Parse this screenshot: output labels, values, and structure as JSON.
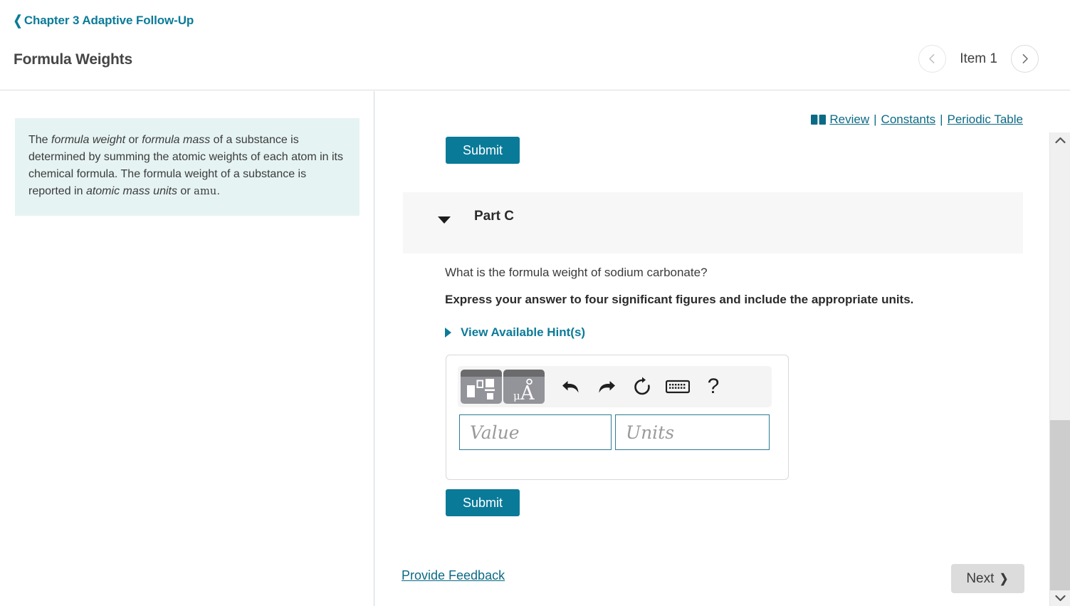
{
  "header": {
    "breadcrumb": "Chapter 3 Adaptive Follow-Up",
    "back_icon": "chevron-left-icon",
    "title": "Formula Weights",
    "item_label": "Item 1",
    "prev_icon": "chevron-left-circle-icon",
    "next_icon": "chevron-right-circle-icon"
  },
  "sidebar": {
    "info_text_segments": {
      "s1": "The ",
      "i1": "formula weight",
      "s2": " or ",
      "i2": "formula mass",
      "s3": " of a substance is determined by summing the atomic weights of each atom in its chemical formula. The formula weight of a substance is reported in ",
      "i3": "atomic mass units",
      "s4": " or ",
      "mono1": "amu",
      "s5": "."
    }
  },
  "tool_links": {
    "book_icon": "open-book-icon",
    "review": "Review",
    "separator": "|",
    "constants": "Constants",
    "periodic_table": "Periodic Table"
  },
  "main": {
    "submit_top_label": "Submit",
    "submit_bottom_label": "Submit",
    "part": {
      "caret_icon": "caret-down-icon",
      "label": "Part C"
    },
    "question": "What is the formula weight of sodium carbonate?",
    "instruction": "Express your answer to four significant figures and include the appropriate units.",
    "hints": {
      "caret_icon": "caret-right-icon",
      "label": "View Available Hint(s)"
    },
    "answer": {
      "toolbar": [
        {
          "name": "template-palette-button",
          "icon": "math-template-palette-icon"
        },
        {
          "name": "units-button",
          "icon": "micro-angstrom-units-icon"
        },
        {
          "name": "undo-button",
          "icon": "undo-arrow-icon"
        },
        {
          "name": "redo-button",
          "icon": "redo-arrow-icon"
        },
        {
          "name": "reset-button",
          "icon": "reset-circular-arrow-icon"
        },
        {
          "name": "keyboard-button",
          "icon": "keyboard-icon"
        },
        {
          "name": "help-button",
          "icon": "question-mark-icon"
        }
      ],
      "help_glyph": "?",
      "value_placeholder": "Value",
      "value": "",
      "units_placeholder": "Units",
      "units": ""
    }
  },
  "footer": {
    "feedback_label": "Provide Feedback",
    "next_label": "Next",
    "next_chevron": "❯"
  },
  "scrollbar": {
    "up_icon": "chevron-up-icon",
    "down_icon": "chevron-down-icon"
  },
  "colors": {
    "accent_teal": "#0a7a99",
    "link_teal": "#0b6a85",
    "info_box_bg": "#e6f3f3",
    "part_band_bg": "#f7f7f7",
    "next_button_bg": "#dcdcdc"
  }
}
